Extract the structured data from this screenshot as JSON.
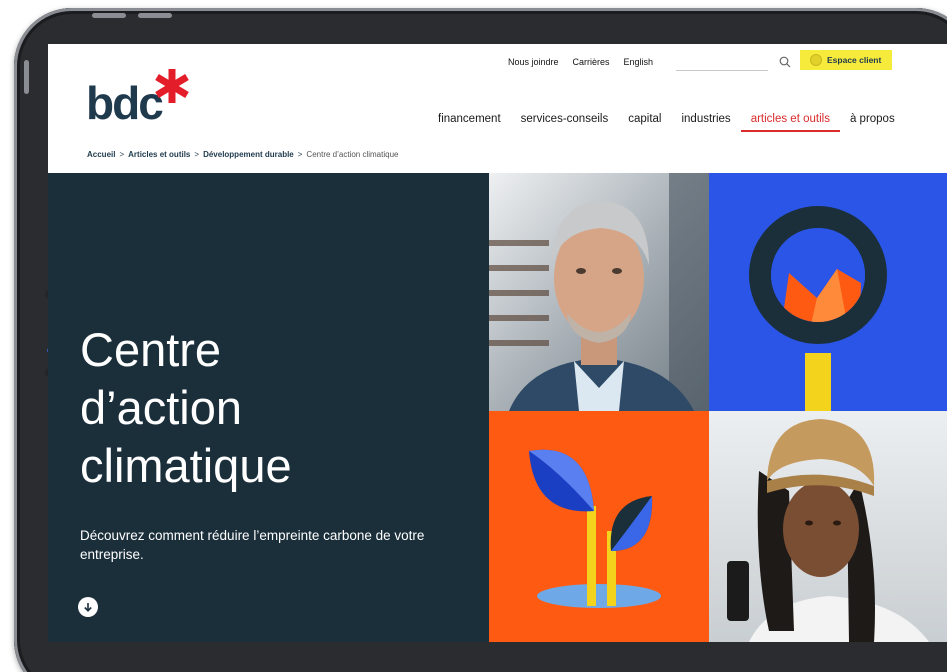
{
  "brand": {
    "logo_text": "bdc",
    "star_color": "#e41d2a",
    "text_color": "#1f3a4d"
  },
  "utility_nav": {
    "items": [
      "Nous joindre",
      "Carrières",
      "English"
    ]
  },
  "search": {
    "placeholder": ""
  },
  "espace_client": {
    "label": "Espace client",
    "color": "#f6ea3b"
  },
  "main_nav": {
    "items": [
      {
        "label": "financement",
        "active": false
      },
      {
        "label": "services-conseils",
        "active": false
      },
      {
        "label": "capital",
        "active": false
      },
      {
        "label": "industries",
        "active": false
      },
      {
        "label": "articles et outils",
        "active": true
      },
      {
        "label": "à propos",
        "active": false
      }
    ],
    "active_color": "#d92c2c"
  },
  "breadcrumb": {
    "items": [
      "Accueil",
      "Articles et outils",
      "Développement durable"
    ],
    "current": "Centre d’action climatique",
    "separator": ">"
  },
  "hero": {
    "title_lines": [
      "Centre",
      "d’action",
      "climatique"
    ],
    "subtitle": "Découvrez comment réduire l’empreinte carbone de votre entreprise.",
    "background": "#1b2f3b"
  },
  "tiles": {
    "blue_bg": "#2a55e6",
    "orange_bg": "#ff5a12",
    "yellow": "#f4d31c"
  }
}
